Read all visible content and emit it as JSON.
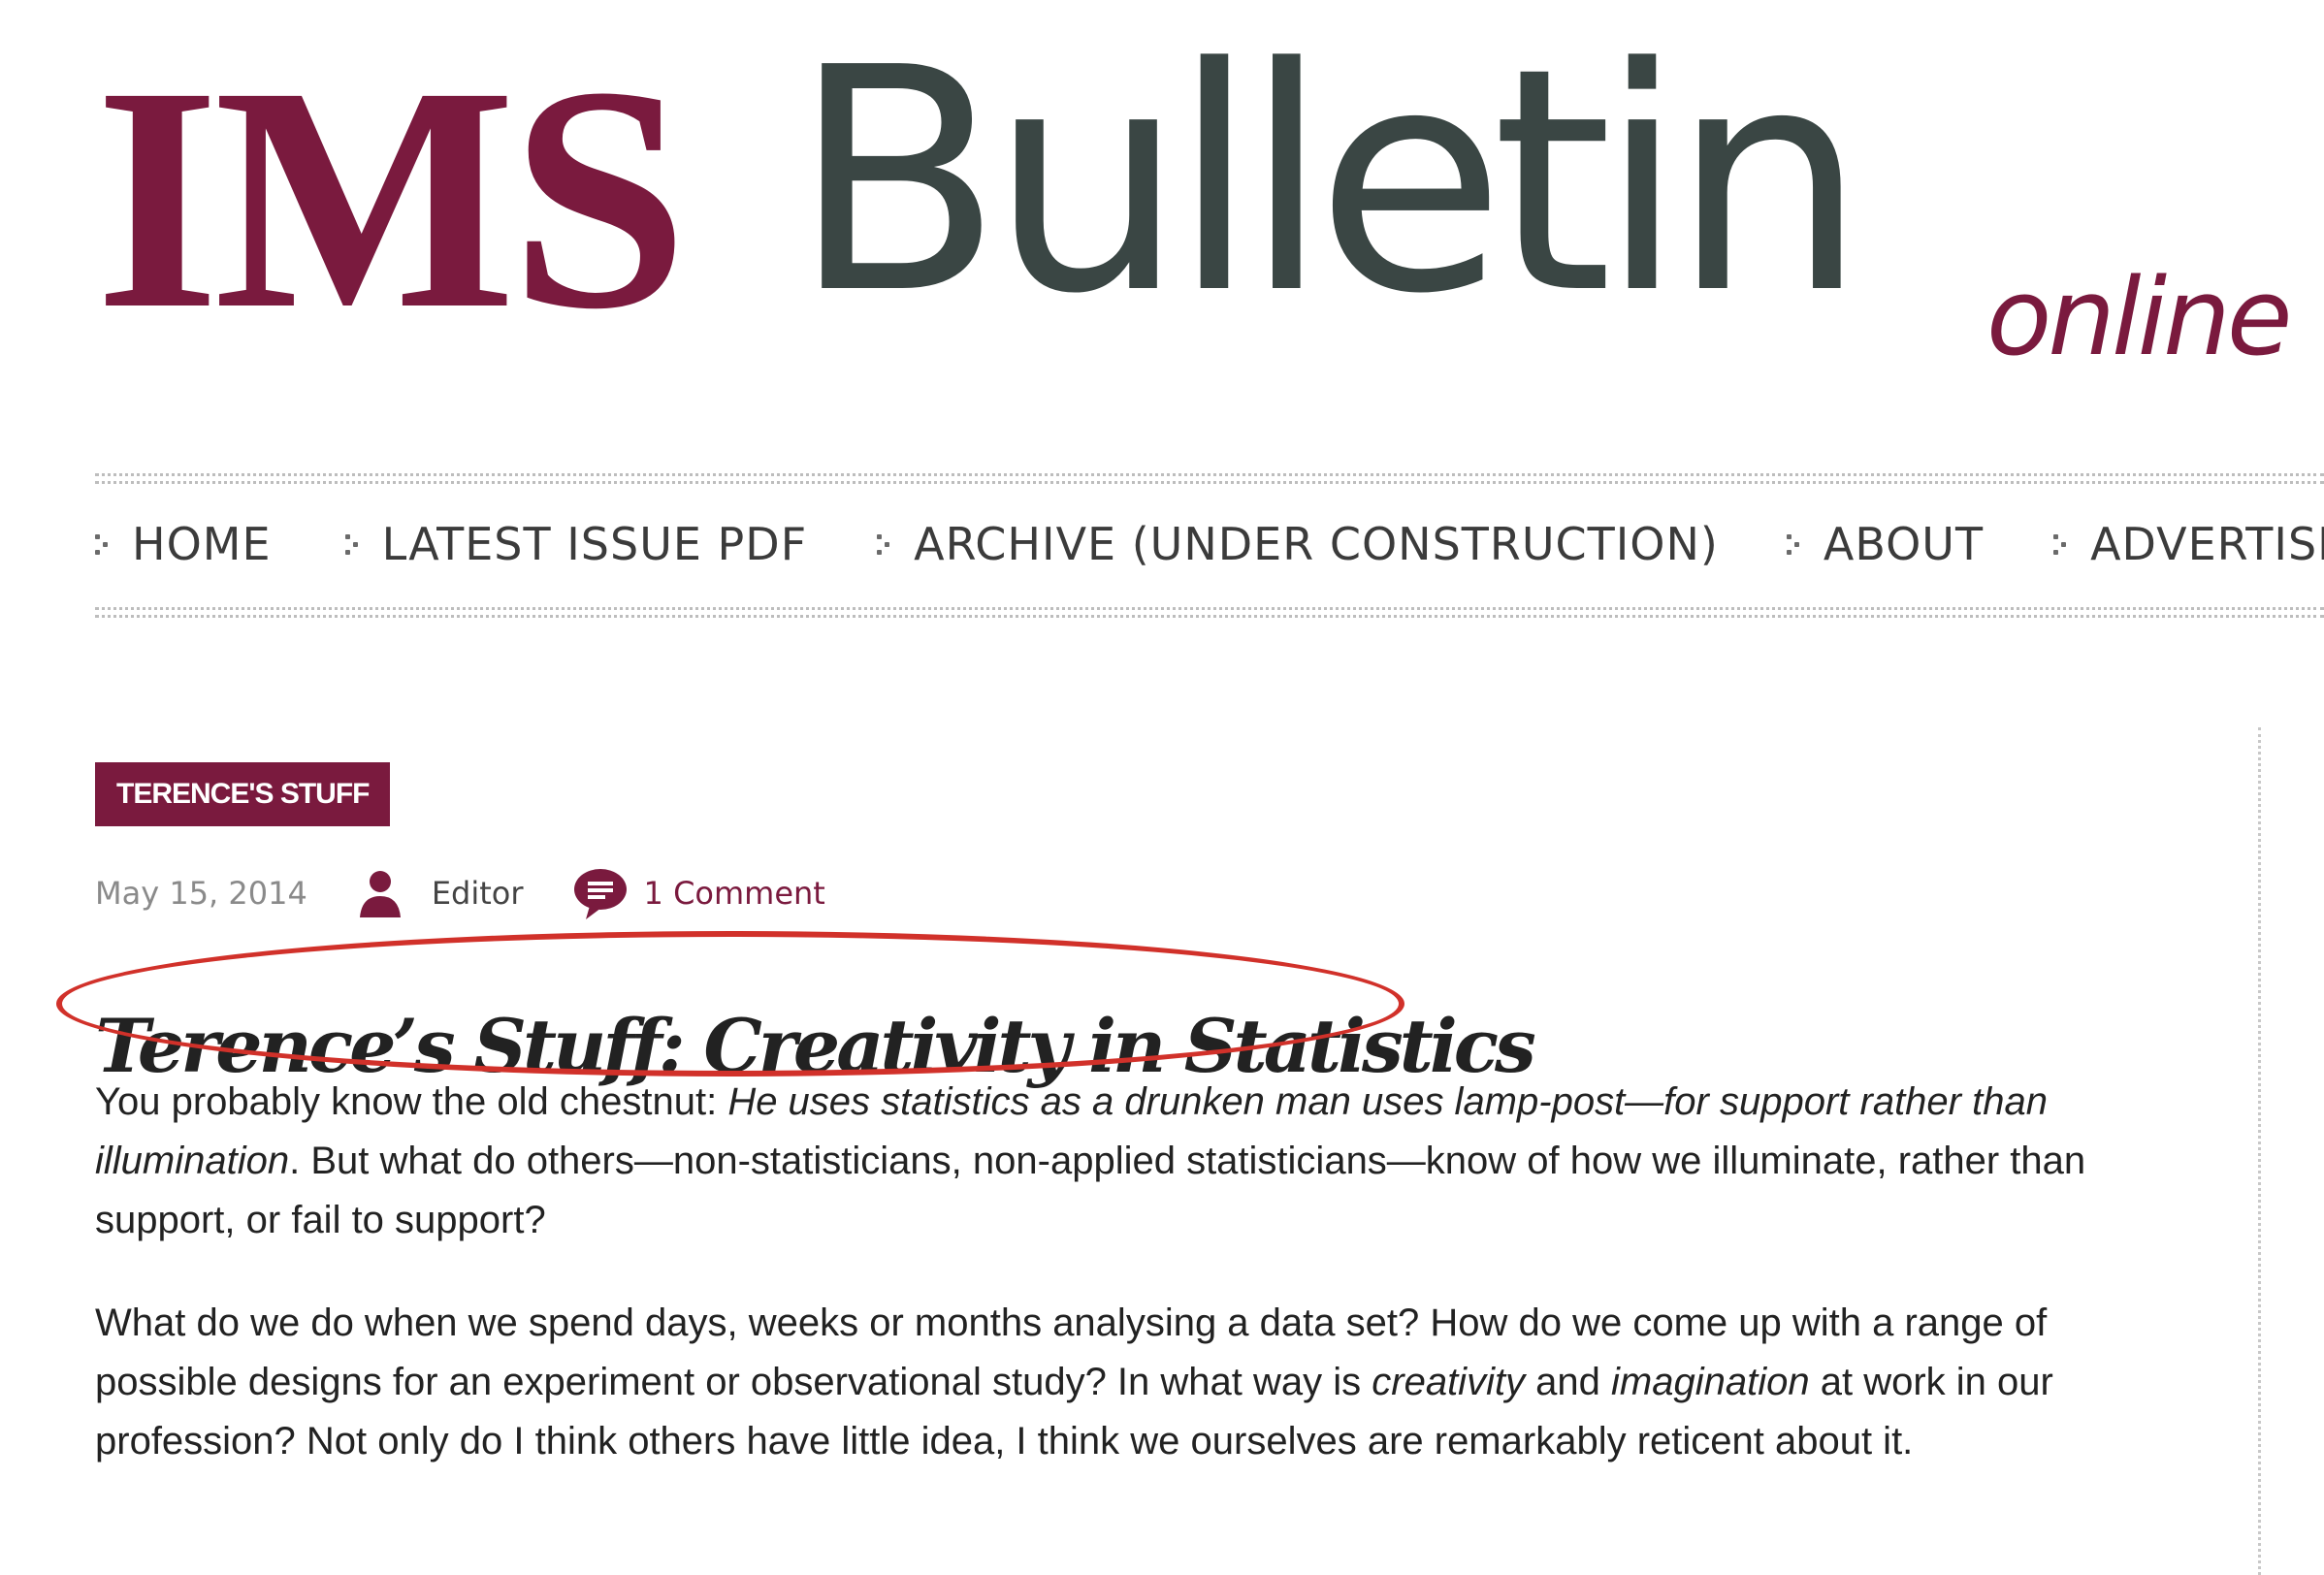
{
  "site": {
    "logo_ims": "IMS",
    "logo_bulletin": "Bulletin",
    "logo_online": "online"
  },
  "nav": {
    "items": [
      {
        "label": "HOME"
      },
      {
        "label": "LATEST ISSUE PDF"
      },
      {
        "label": "ARCHIVE (UNDER CONSTRUCTION)"
      },
      {
        "label": "ABOUT"
      },
      {
        "label": "ADVERTISE"
      }
    ]
  },
  "post": {
    "category": "TERENCE'S STUFF",
    "date": "May 15, 2014",
    "author": "Editor",
    "comments": "1 Comment",
    "title": "Terence’s Stuff: Creativity in Statistics",
    "p1": {
      "t1": "You probably know the old chestnut: ",
      "t2": "He uses statistics as a drunken man uses lamp-post—for support rather than illumination",
      "t3": ". But what do others—non-statisticians, non-applied statisticians—know of how we illuminate, rather than support, or fail to support?"
    },
    "p2": {
      "t1": "What do we do when we spend days, weeks or months analysing a data set? How do we come up with a range of possible designs for an experiment or observational study? In what way is ",
      "t2": "creativity",
      "t3": " and ",
      "t4": "imagination",
      "t5": " at work in our profession? Not only do I think others have little idea, I think we ourselves are remarkably reticent about it."
    }
  },
  "colors": {
    "brand": "#7a1a3e",
    "logo_gray": "#3a4644",
    "annotation": "#d1312a"
  }
}
